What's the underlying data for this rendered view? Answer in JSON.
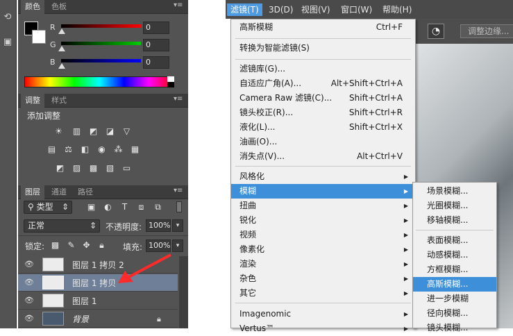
{
  "color_panel": {
    "tabs": [
      "颜色",
      "色板"
    ],
    "sliders": [
      {
        "label": "R",
        "value": "0"
      },
      {
        "label": "G",
        "value": "0"
      },
      {
        "label": "B",
        "value": "0"
      }
    ]
  },
  "adjust_panel": {
    "tabs": [
      "调整",
      "样式"
    ],
    "title": "添加调整"
  },
  "layers_panel": {
    "tabs": [
      "图层",
      "通道",
      "路径"
    ],
    "filter_label": "类型",
    "blend_mode": "正常",
    "opacity_label": "不透明度:",
    "opacity_value": "100%",
    "lock_label": "锁定:",
    "fill_label": "填充:",
    "fill_value": "100%",
    "layers": [
      {
        "name": "图层 1 拷贝 2",
        "selected": false
      },
      {
        "name": "图层 1 拷贝",
        "selected": true
      },
      {
        "name": "图层 1",
        "selected": false
      },
      {
        "name": "背景",
        "selected": false,
        "locked": true
      }
    ]
  },
  "menubar": {
    "items": [
      "滤镜(T)",
      "3D(D)",
      "视图(V)",
      "窗口(W)",
      "帮助(H)"
    ],
    "open_index": 0
  },
  "filter_menu": {
    "items": [
      {
        "label": "高斯模糊",
        "shortcut": "Ctrl+F"
      },
      {
        "label": "转换为智能滤镜(S)",
        "shortcut": ""
      },
      {
        "label": "滤镜库(G)...",
        "shortcut": ""
      },
      {
        "label": "自适应广角(A)...",
        "shortcut": "Alt+Shift+Ctrl+A"
      },
      {
        "label": "Camera Raw 滤镜(C)...",
        "shortcut": "Shift+Ctrl+A"
      },
      {
        "label": "镜头校正(R)...",
        "shortcut": "Shift+Ctrl+R"
      },
      {
        "label": "液化(L)...",
        "shortcut": "Shift+Ctrl+X"
      },
      {
        "label": "油画(O)...",
        "shortcut": ""
      },
      {
        "label": "消失点(V)...",
        "shortcut": "Alt+Ctrl+V"
      },
      {
        "label": "风格化",
        "shortcut": "",
        "submenu": true
      },
      {
        "label": "模糊",
        "shortcut": "",
        "submenu": true,
        "highlighted": true
      },
      {
        "label": "扭曲",
        "shortcut": "",
        "submenu": true
      },
      {
        "label": "锐化",
        "shortcut": "",
        "submenu": true
      },
      {
        "label": "视频",
        "shortcut": "",
        "submenu": true
      },
      {
        "label": "像素化",
        "shortcut": "",
        "submenu": true
      },
      {
        "label": "渲染",
        "shortcut": "",
        "submenu": true
      },
      {
        "label": "杂色",
        "shortcut": "",
        "submenu": true
      },
      {
        "label": "其它",
        "shortcut": "",
        "submenu": true
      },
      {
        "label": "Imagenomic",
        "shortcut": "",
        "submenu": true
      },
      {
        "label": "Vertus™",
        "shortcut": "",
        "submenu": true
      }
    ]
  },
  "blur_submenu": {
    "items": [
      "场景模糊...",
      "光圈模糊...",
      "移轴模糊...",
      "表面模糊...",
      "动感模糊...",
      "方框模糊...",
      "高斯模糊...",
      "进一步模糊",
      "径向模糊...",
      "镜头模糊..."
    ],
    "highlighted_index": 6
  },
  "options_bar": {
    "refine_edge_label": "调整边缘..."
  }
}
